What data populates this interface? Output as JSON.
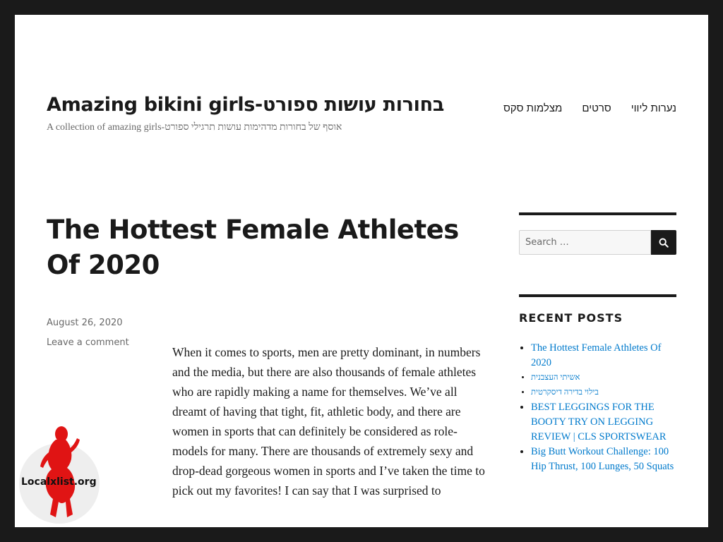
{
  "site": {
    "title": "Amazing bikini girls-בחורות עושות ספורט",
    "description": "A collection of amazing girls-אוסף של בחורות מדהימות עושות תרגילי ספורט"
  },
  "nav": {
    "items": [
      "מצלמות סקס",
      "סרטים",
      "נערות ליווי"
    ]
  },
  "post": {
    "title": "The Hottest Female Athletes Of 2020",
    "date": "August 26, 2020",
    "comment_link": "Leave a comment",
    "content": "When it comes to sports, men are pretty dominant, in numbers and the media, but there are also thousands of female athletes who are rapidly making a name for themselves. We’ve all dreamt of having that tight, fit, athletic body, and there are women in sports that can definitely be considered as role-models for many. There are thousands of extremely sexy and drop-dead gorgeous women in sports and I’ve taken the time to pick out my favorites! I can say that I was surprised to"
  },
  "search": {
    "placeholder": "Search …",
    "icon": "search-icon"
  },
  "recent_posts": {
    "title": "RECENT POSTS",
    "items": [
      "The Hottest Female Athletes Of 2020",
      "אשיתי העצבנית",
      "בילוי בדירה דיסקרטית",
      "BEST LEGGINGS FOR THE BOOTY TRY ON LEGGING REVIEW | CLS SPORTSWEAR",
      "Big Butt Workout Challenge: 100 Hip Thrust, 100 Lunges, 50 Squats"
    ]
  },
  "watermark": {
    "text": "Localxlist.org"
  },
  "colors": {
    "frame": "#1a1a1a",
    "page_background": "#ffffff",
    "link": "#007acc",
    "muted_text": "#686868",
    "watermark_figure": "#e01414"
  }
}
